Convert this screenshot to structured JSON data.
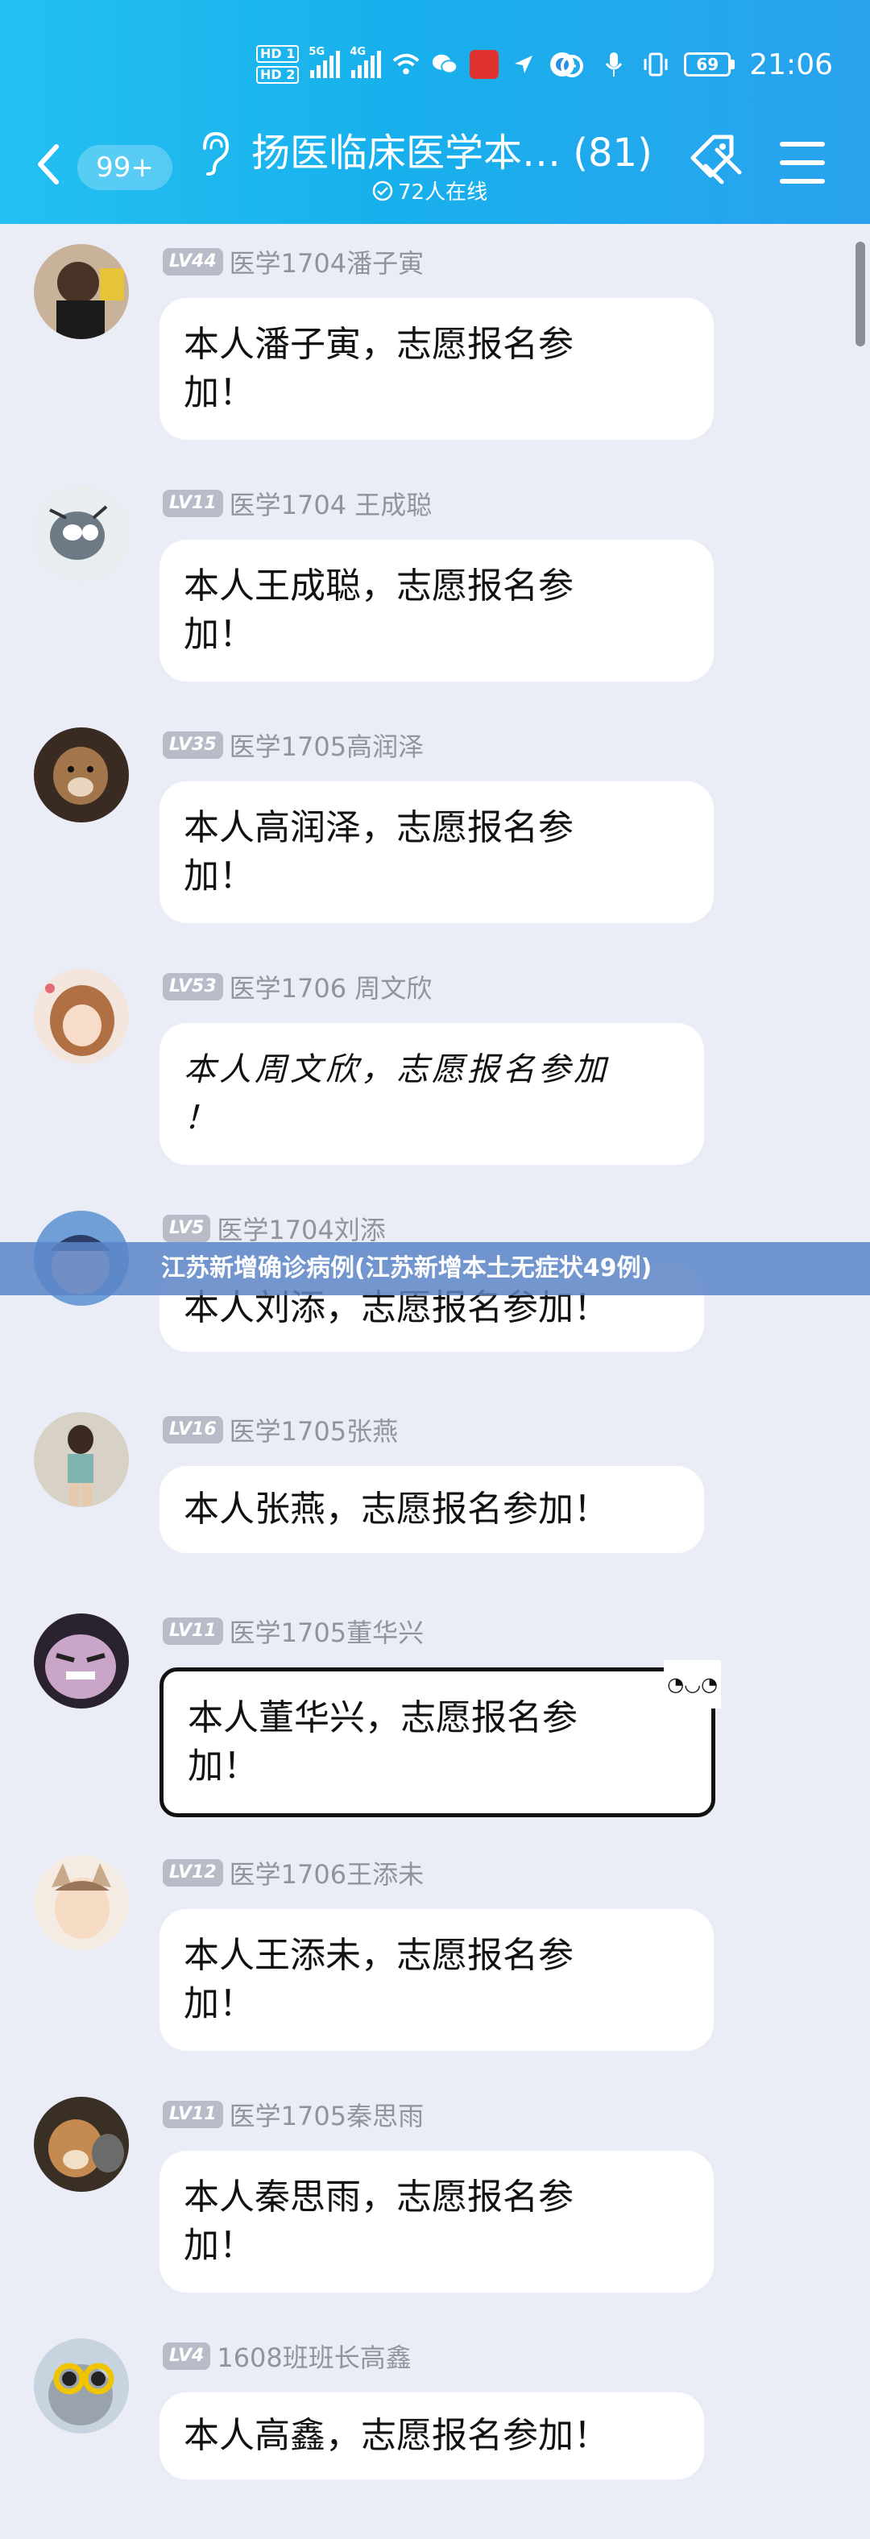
{
  "status_bar": {
    "hd_top": "HD 1",
    "hd_bottom": "HD 2",
    "sig1_tag": "5G",
    "sig2_tag": "4G",
    "battery": "69",
    "time": "21:06"
  },
  "nav": {
    "unread": "99+",
    "title": "扬医临床医学本… (81)",
    "online": "72人在线"
  },
  "colors": {
    "header_start": "#24c0f2",
    "header_end": "#2aa2ee",
    "background": "#eaedf5",
    "level_badge": "#b7bcc8"
  },
  "messages": [
    {
      "level": "LV44",
      "name": "医学1704潘子寅",
      "line1": "本人潘子寅，志愿报名参",
      "line2": "加！"
    },
    {
      "level": "LV11",
      "name": "医学1704 王成聪",
      "line1": "本人王成聪，志愿报名参",
      "line2": "加！"
    },
    {
      "level": "LV35",
      "name": "医学1705高润泽",
      "line1": "本人高润泽，志愿报名参",
      "line2": "加！"
    },
    {
      "level": "LV53",
      "name": "医学1706 周文欣",
      "line1": "本人周文欣，志愿报名参加",
      "line2": "！"
    },
    {
      "level": "LV5",
      "name": "医学1704刘添",
      "line1": "本人刘添，志愿报名参加！"
    },
    {
      "level": "LV16",
      "name": "医学1705张燕",
      "line1": "本人张燕，志愿报名参加！"
    },
    {
      "level": "LV11",
      "name": "医学1705董华兴",
      "line1": "本人董华兴，志愿报名参",
      "line2": "加！",
      "face": "◔◡◔"
    },
    {
      "level": "LV12",
      "name": "医学1706王添未",
      "line1": "本人王添未，志愿报名参",
      "line2": "加！"
    },
    {
      "level": "LV11",
      "name": "医学1705秦思雨",
      "line1": "本人秦思雨，志愿报名参",
      "line2": "加！"
    },
    {
      "level": "LV4",
      "name": "1608班班长高鑫",
      "line1": "本人高鑫，志愿报名参加！"
    }
  ],
  "banner": {
    "text": "江苏新增确诊病例(江苏新增本土无症状49例)"
  }
}
